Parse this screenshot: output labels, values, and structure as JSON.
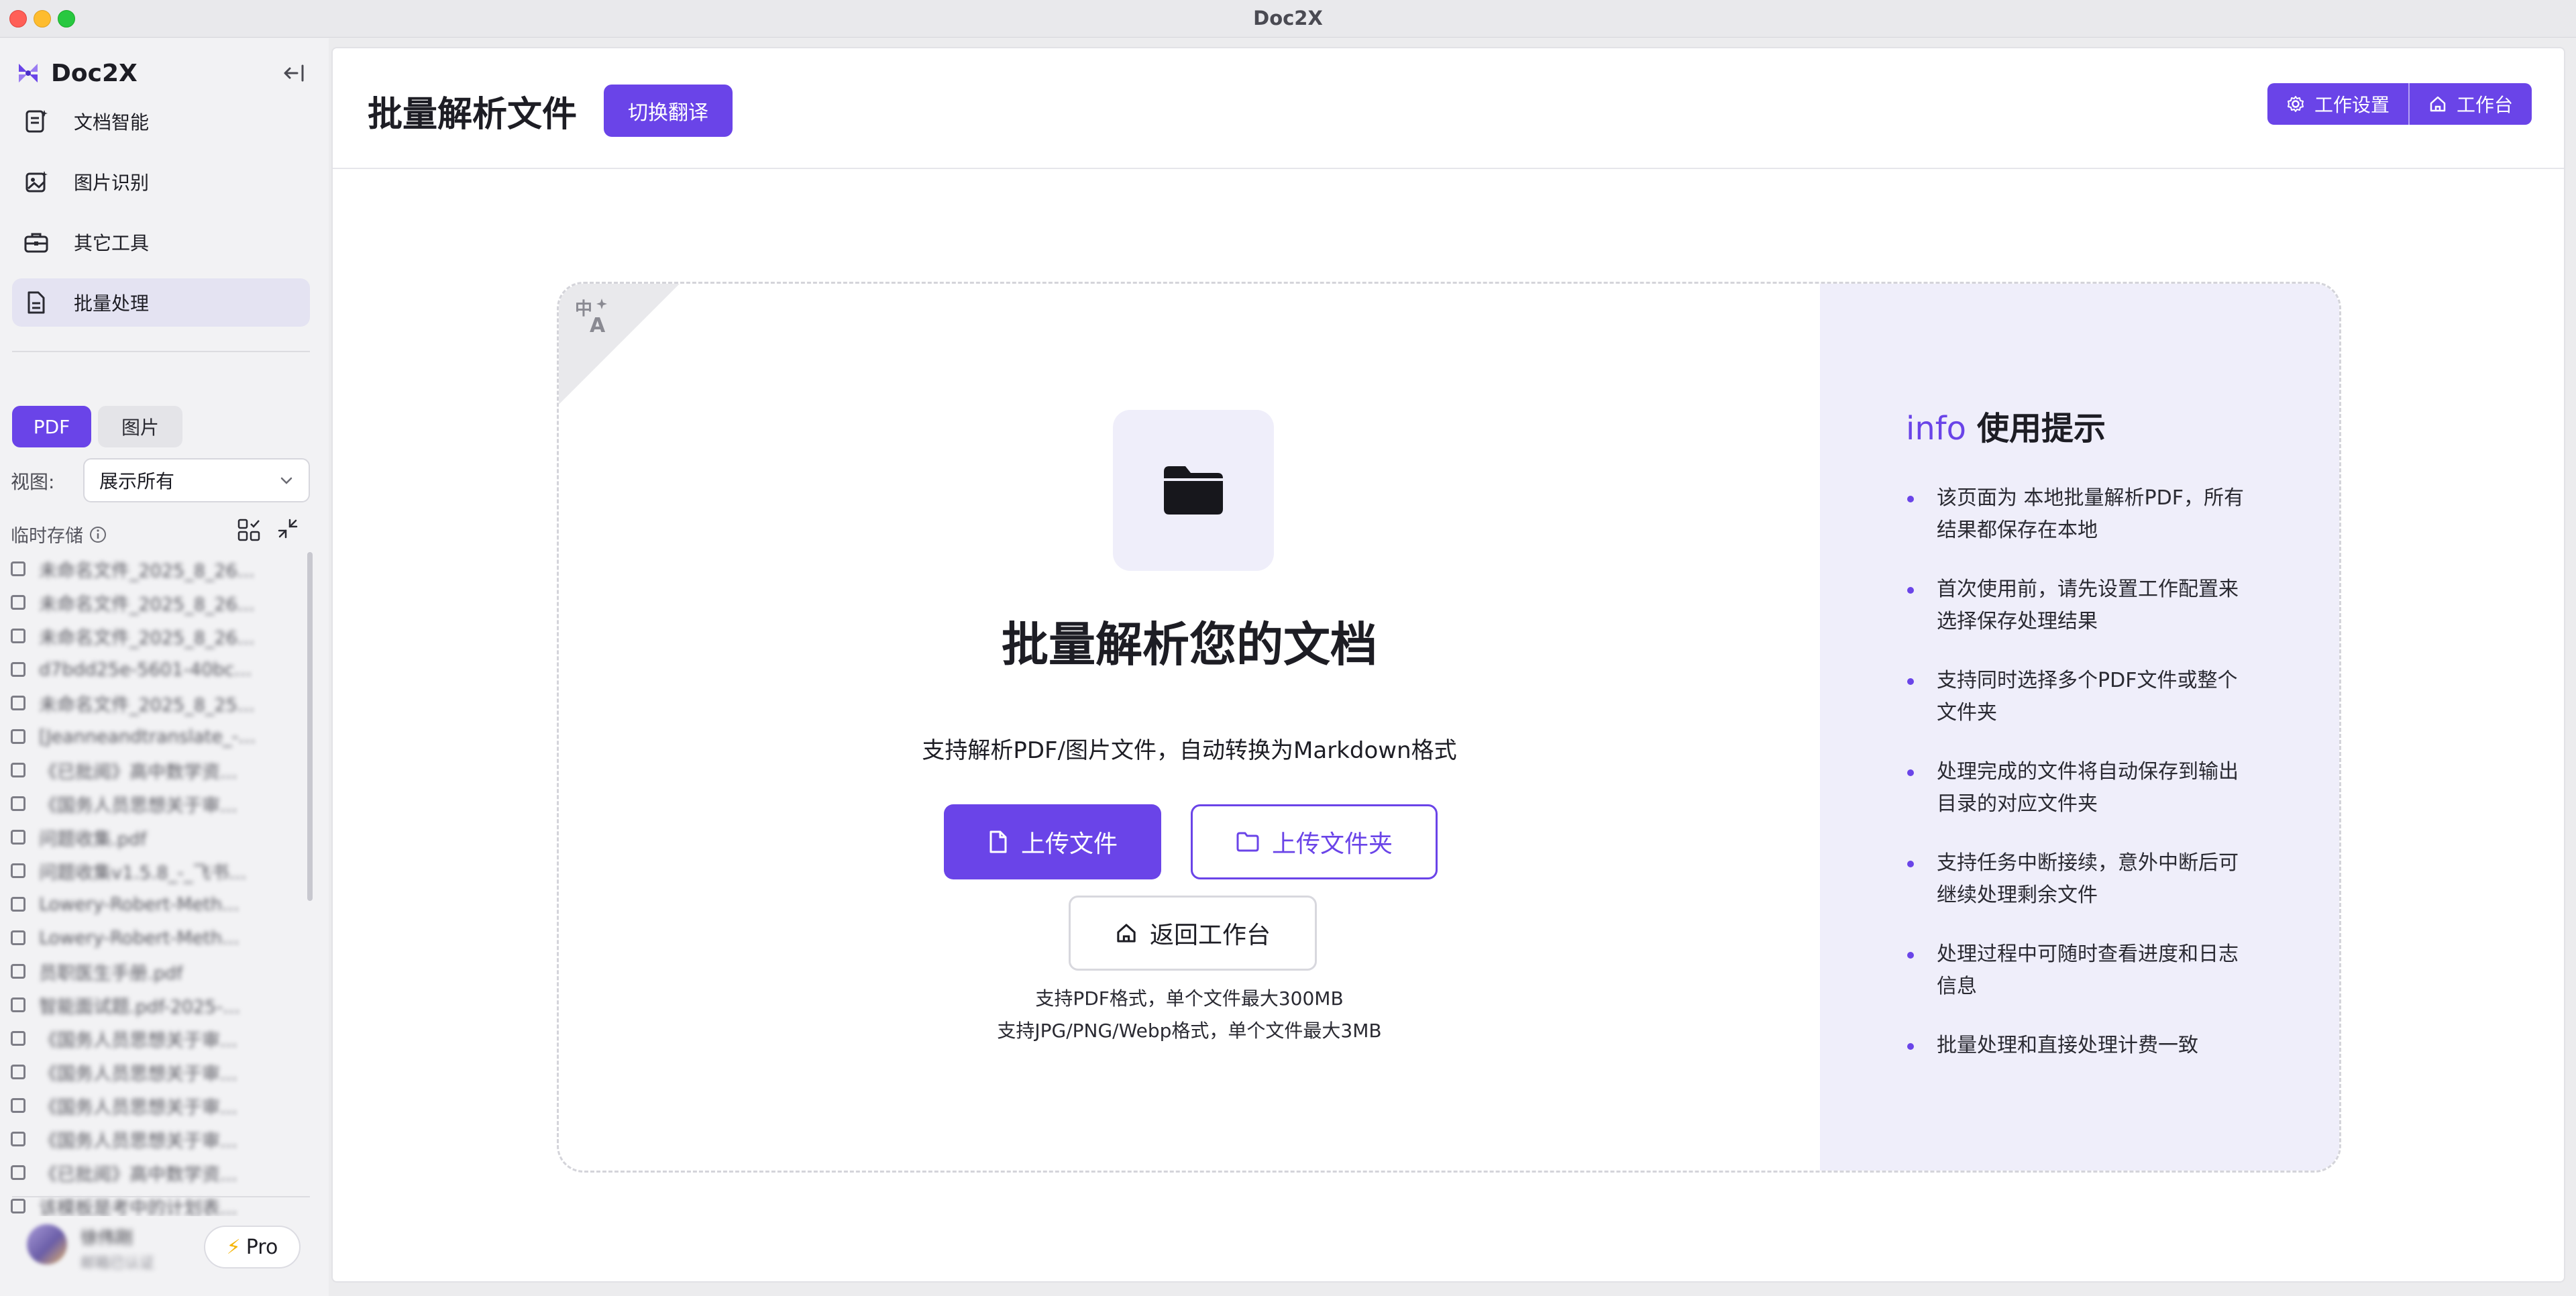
{
  "window": {
    "title": "Doc2X"
  },
  "sidebar": {
    "brand": "Doc2X",
    "nav": [
      {
        "label": "文档智能",
        "icon": "document-ai-icon"
      },
      {
        "label": "图片识别",
        "icon": "image-recognition-icon"
      },
      {
        "label": "其它工具",
        "icon": "toolbox-icon"
      },
      {
        "label": "批量处理",
        "icon": "batch-document-icon",
        "active": true
      }
    ],
    "tabs": [
      {
        "label": "PDF",
        "active": true
      },
      {
        "label": "图片"
      }
    ],
    "view_label": "视图:",
    "view_value": "展示所有",
    "temp_label": "临时存储",
    "files": [
      "未命名文件_2025_8_26...",
      "未命名文件_2025_8_26...",
      "未命名文件_2025_8_26...",
      "d7bdd25e-5601-40bc...",
      "未命名文件_2025_8_25...",
      "[Jeanneandtranslate_-...",
      "《已批阅》高中数学资...",
      "《国务人员思想关于审...",
      "问题收集.pdf",
      "问题收集v1.5.8_-_飞书...",
      "Lowery-Robert-Meth...",
      "Lowery-Robert-Meth...",
      "员职医生手册.pdf",
      "智能面试题.pdf-2025-...",
      "《国务人员思想关于审...",
      "《国务人员思想关于审...",
      "《国务人员思想关于审...",
      "《国务人员思想关于审...",
      "《已批阅》高中数学资...",
      "该模板是考中的计划表..."
    ],
    "user": {
      "name": "徐伟刚",
      "sub": "邮箱已认证"
    },
    "pro_label": "Pro"
  },
  "header": {
    "title": "批量解析文件",
    "switch_label": "切换翻译",
    "settings_label": "工作设置",
    "workbench_label": "工作台"
  },
  "upload": {
    "title": "批量解析您的文档",
    "subtitle": "支持解析PDF/图片文件，自动转换为Markdown格式",
    "upload_file": "上传文件",
    "upload_folder": "上传文件夹",
    "back": "返回工作台",
    "note_pdf": "支持PDF格式，单个文件最大300MB",
    "note_img": "支持JPG/PNG/Webp格式，单个文件最大3MB"
  },
  "tips": {
    "accent": "info",
    "title": "使用提示",
    "items": [
      "该页面为 本地批量解析PDF，所有结果都保存在本地",
      "首次使用前，请先设置工作配置来选择保存处理结果",
      "支持同时选择多个PDF文件或整个文件夹",
      "处理完成的文件将自动保存到输出目录的对应文件夹",
      "支持任务中断接续，意外中断后可继续处理剩余文件",
      "处理过程中可随时查看进度和日志信息",
      "批量处理和直接处理计费一致"
    ]
  },
  "colors": {
    "accent": "#6a44e8",
    "panel": "#efeefa"
  }
}
